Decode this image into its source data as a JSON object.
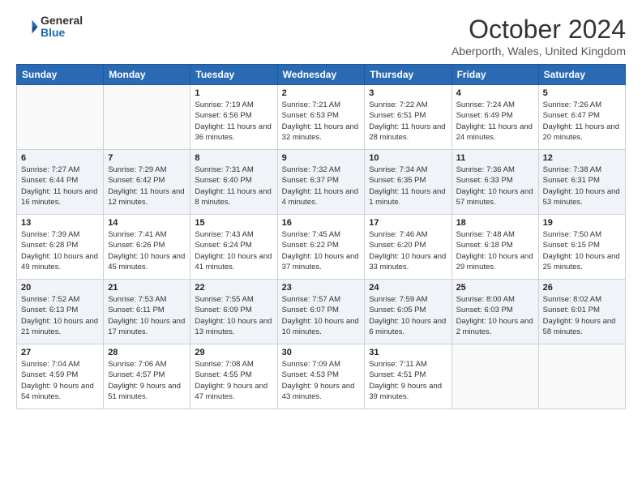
{
  "logo": {
    "general": "General",
    "blue": "Blue"
  },
  "header": {
    "month": "October 2024",
    "location": "Aberporth, Wales, United Kingdom"
  },
  "weekdays": [
    "Sunday",
    "Monday",
    "Tuesday",
    "Wednesday",
    "Thursday",
    "Friday",
    "Saturday"
  ],
  "weeks": [
    [
      {
        "day": "",
        "info": ""
      },
      {
        "day": "",
        "info": ""
      },
      {
        "day": "1",
        "info": "Sunrise: 7:19 AM\nSunset: 6:56 PM\nDaylight: 11 hours and 36 minutes."
      },
      {
        "day": "2",
        "info": "Sunrise: 7:21 AM\nSunset: 6:53 PM\nDaylight: 11 hours and 32 minutes."
      },
      {
        "day": "3",
        "info": "Sunrise: 7:22 AM\nSunset: 6:51 PM\nDaylight: 11 hours and 28 minutes."
      },
      {
        "day": "4",
        "info": "Sunrise: 7:24 AM\nSunset: 6:49 PM\nDaylight: 11 hours and 24 minutes."
      },
      {
        "day": "5",
        "info": "Sunrise: 7:26 AM\nSunset: 6:47 PM\nDaylight: 11 hours and 20 minutes."
      }
    ],
    [
      {
        "day": "6",
        "info": "Sunrise: 7:27 AM\nSunset: 6:44 PM\nDaylight: 11 hours and 16 minutes."
      },
      {
        "day": "7",
        "info": "Sunrise: 7:29 AM\nSunset: 6:42 PM\nDaylight: 11 hours and 12 minutes."
      },
      {
        "day": "8",
        "info": "Sunrise: 7:31 AM\nSunset: 6:40 PM\nDaylight: 11 hours and 8 minutes."
      },
      {
        "day": "9",
        "info": "Sunrise: 7:32 AM\nSunset: 6:37 PM\nDaylight: 11 hours and 4 minutes."
      },
      {
        "day": "10",
        "info": "Sunrise: 7:34 AM\nSunset: 6:35 PM\nDaylight: 11 hours and 1 minute."
      },
      {
        "day": "11",
        "info": "Sunrise: 7:36 AM\nSunset: 6:33 PM\nDaylight: 10 hours and 57 minutes."
      },
      {
        "day": "12",
        "info": "Sunrise: 7:38 AM\nSunset: 6:31 PM\nDaylight: 10 hours and 53 minutes."
      }
    ],
    [
      {
        "day": "13",
        "info": "Sunrise: 7:39 AM\nSunset: 6:28 PM\nDaylight: 10 hours and 49 minutes."
      },
      {
        "day": "14",
        "info": "Sunrise: 7:41 AM\nSunset: 6:26 PM\nDaylight: 10 hours and 45 minutes."
      },
      {
        "day": "15",
        "info": "Sunrise: 7:43 AM\nSunset: 6:24 PM\nDaylight: 10 hours and 41 minutes."
      },
      {
        "day": "16",
        "info": "Sunrise: 7:45 AM\nSunset: 6:22 PM\nDaylight: 10 hours and 37 minutes."
      },
      {
        "day": "17",
        "info": "Sunrise: 7:46 AM\nSunset: 6:20 PM\nDaylight: 10 hours and 33 minutes."
      },
      {
        "day": "18",
        "info": "Sunrise: 7:48 AM\nSunset: 6:18 PM\nDaylight: 10 hours and 29 minutes."
      },
      {
        "day": "19",
        "info": "Sunrise: 7:50 AM\nSunset: 6:15 PM\nDaylight: 10 hours and 25 minutes."
      }
    ],
    [
      {
        "day": "20",
        "info": "Sunrise: 7:52 AM\nSunset: 6:13 PM\nDaylight: 10 hours and 21 minutes."
      },
      {
        "day": "21",
        "info": "Sunrise: 7:53 AM\nSunset: 6:11 PM\nDaylight: 10 hours and 17 minutes."
      },
      {
        "day": "22",
        "info": "Sunrise: 7:55 AM\nSunset: 6:09 PM\nDaylight: 10 hours and 13 minutes."
      },
      {
        "day": "23",
        "info": "Sunrise: 7:57 AM\nSunset: 6:07 PM\nDaylight: 10 hours and 10 minutes."
      },
      {
        "day": "24",
        "info": "Sunrise: 7:59 AM\nSunset: 6:05 PM\nDaylight: 10 hours and 6 minutes."
      },
      {
        "day": "25",
        "info": "Sunrise: 8:00 AM\nSunset: 6:03 PM\nDaylight: 10 hours and 2 minutes."
      },
      {
        "day": "26",
        "info": "Sunrise: 8:02 AM\nSunset: 6:01 PM\nDaylight: 9 hours and 58 minutes."
      }
    ],
    [
      {
        "day": "27",
        "info": "Sunrise: 7:04 AM\nSunset: 4:59 PM\nDaylight: 9 hours and 54 minutes."
      },
      {
        "day": "28",
        "info": "Sunrise: 7:06 AM\nSunset: 4:57 PM\nDaylight: 9 hours and 51 minutes."
      },
      {
        "day": "29",
        "info": "Sunrise: 7:08 AM\nSunset: 4:55 PM\nDaylight: 9 hours and 47 minutes."
      },
      {
        "day": "30",
        "info": "Sunrise: 7:09 AM\nSunset: 4:53 PM\nDaylight: 9 hours and 43 minutes."
      },
      {
        "day": "31",
        "info": "Sunrise: 7:11 AM\nSunset: 4:51 PM\nDaylight: 9 hours and 39 minutes."
      },
      {
        "day": "",
        "info": ""
      },
      {
        "day": "",
        "info": ""
      }
    ]
  ]
}
